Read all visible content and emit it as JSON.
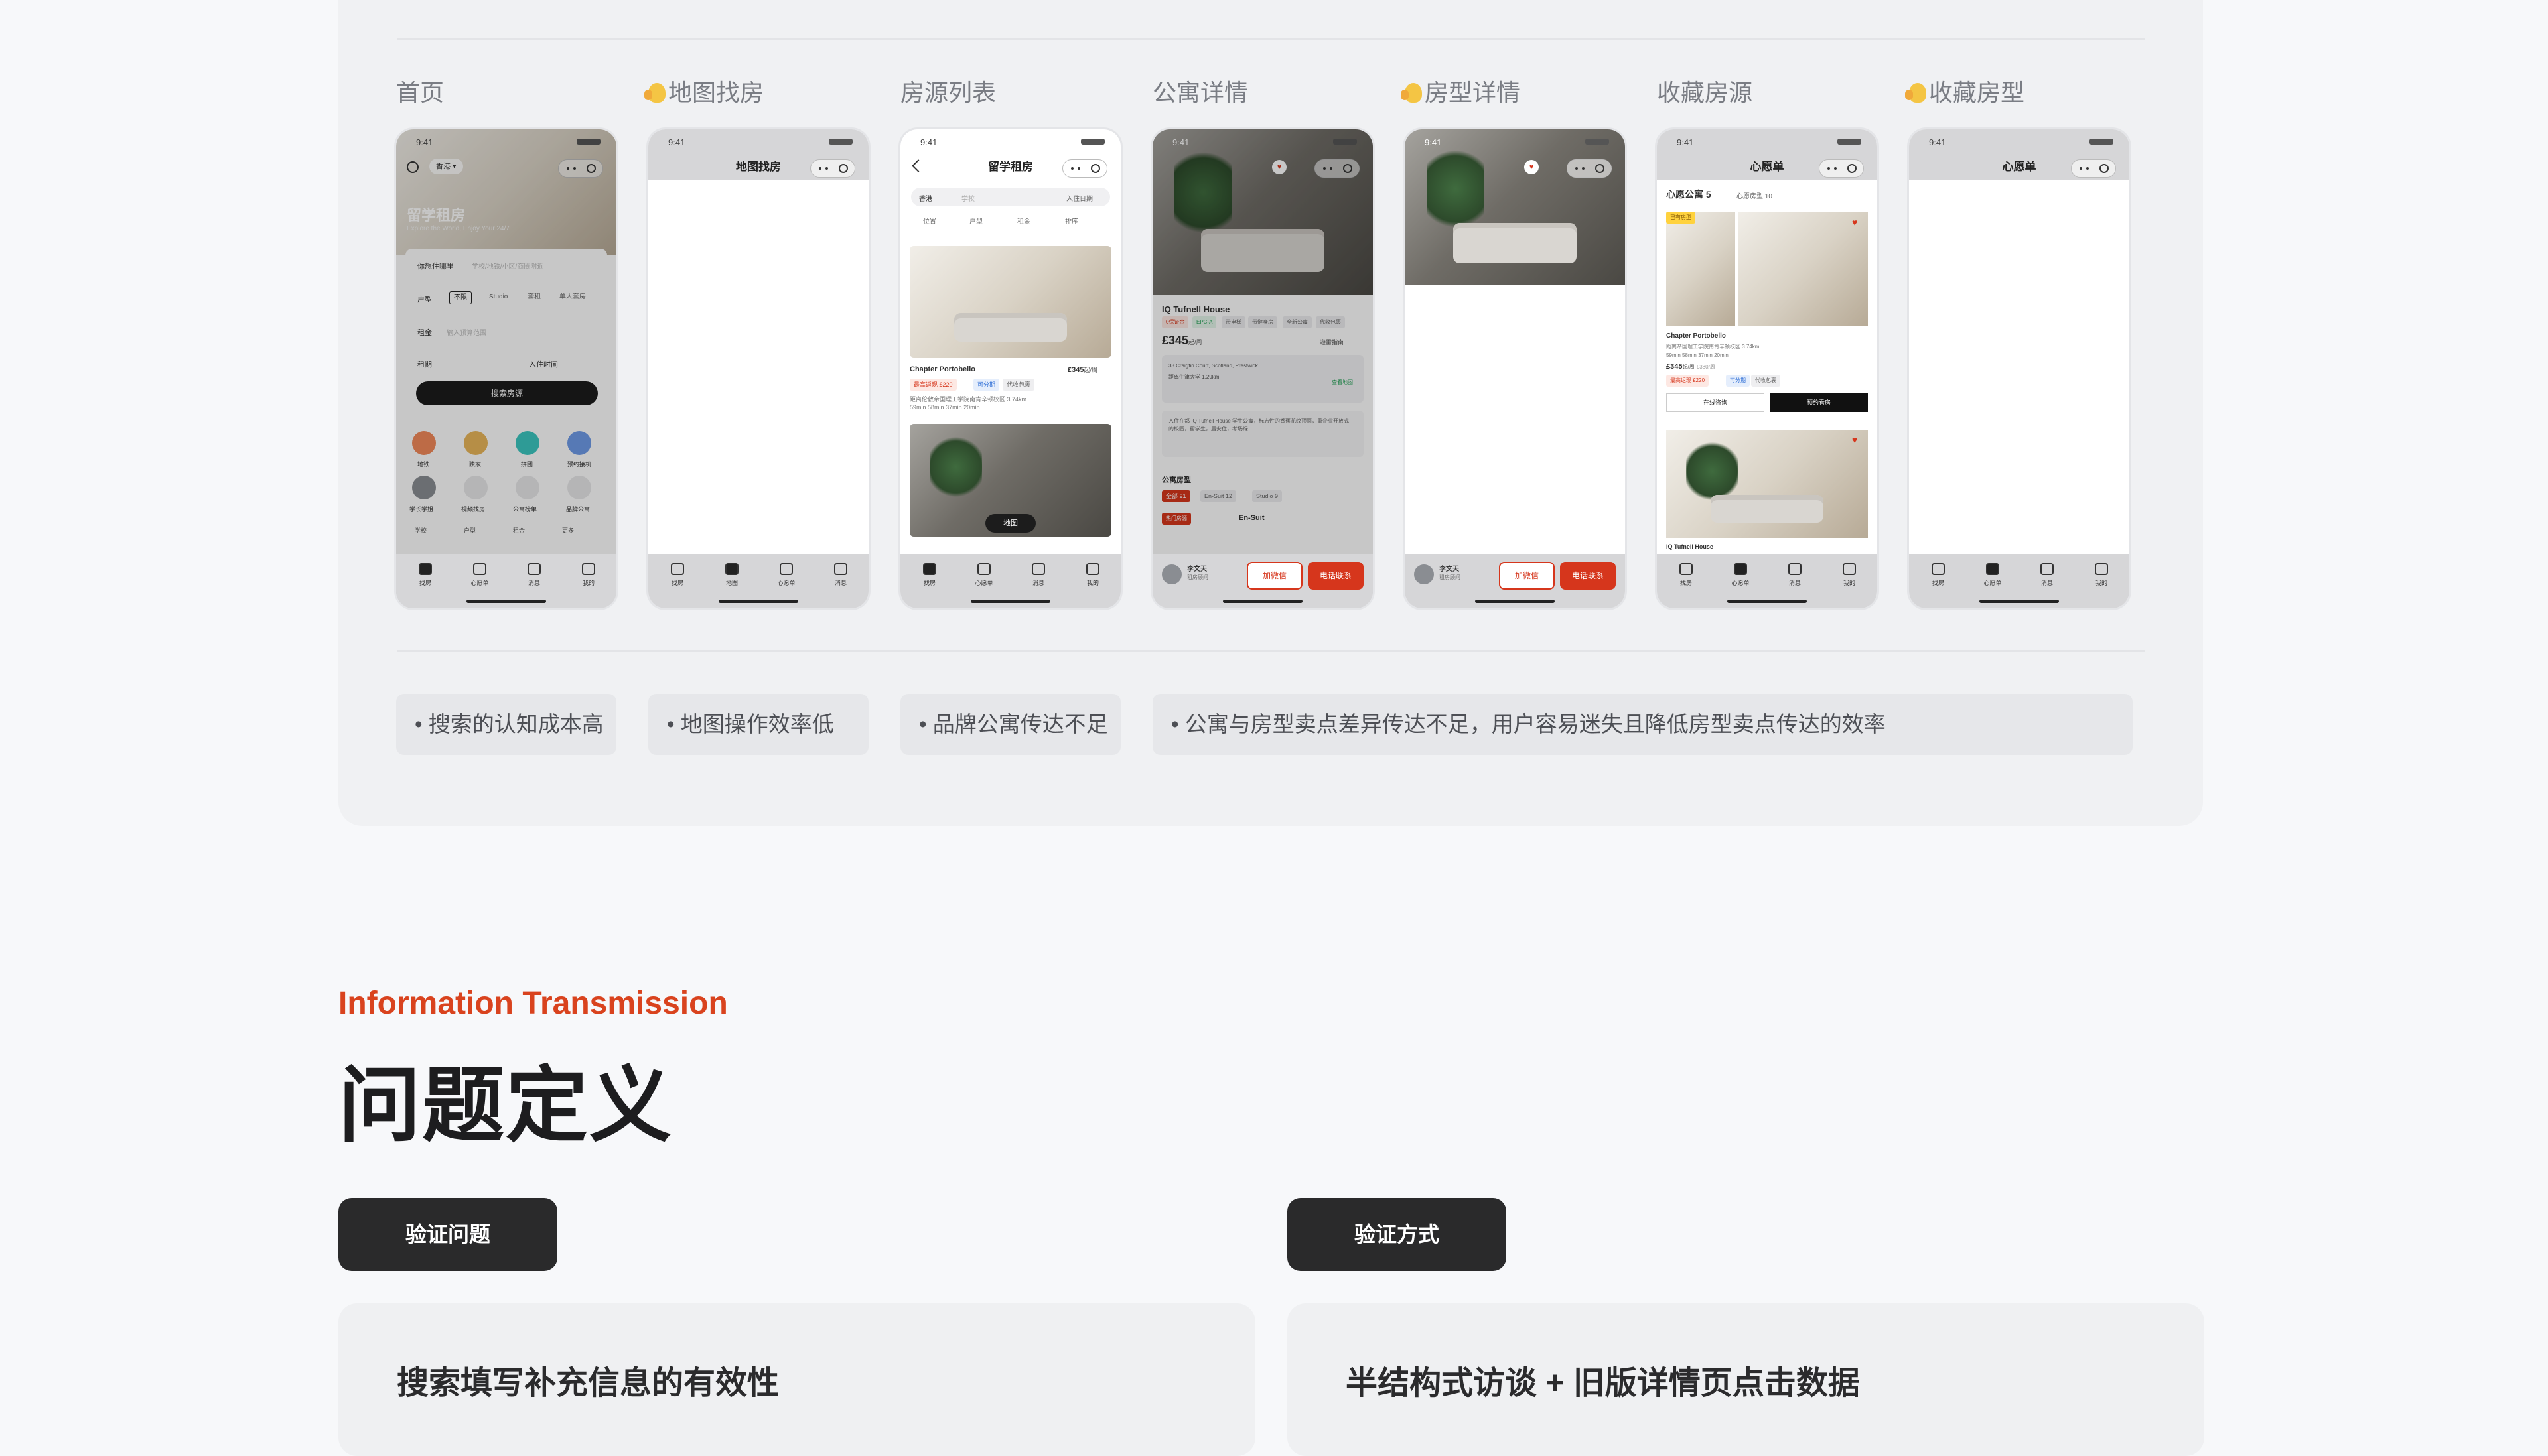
{
  "screens": [
    {
      "label": "首页",
      "emoji": false
    },
    {
      "label": "地图找房",
      "emoji": true
    },
    {
      "label": "房源列表",
      "emoji": false
    },
    {
      "label": "公寓详情",
      "emoji": false
    },
    {
      "label": "房型详情",
      "emoji": true
    },
    {
      "label": "收藏房源",
      "emoji": false
    },
    {
      "label": "收藏房型",
      "emoji": true
    }
  ],
  "phones": {
    "time": "9:41",
    "home": {
      "city": "香港",
      "hero_title": "留学租房",
      "hero_sub": "Explore the World, Enjoy Your 24/7",
      "field_school": "你想住哪里",
      "field_school_ph": "学校/地铁/小区/商圈附近",
      "field_type": "户型",
      "type_options": [
        "不限",
        "Studio",
        "套租",
        "单人套房"
      ],
      "field_rent": "租金",
      "field_rent_ph": "输入预算范围",
      "field_term": "租期",
      "field_checkin": "入住时间",
      "search_btn": "搜索房源",
      "cats": [
        "地铁",
        "独家",
        "拼团",
        "预约接机",
        "学长学姐",
        "视频找房",
        "公寓榜单",
        "品牌公寓"
      ],
      "filters": [
        "学校",
        "户型",
        "租金",
        "更多"
      ]
    },
    "map": {
      "nav_title": "地图找房"
    },
    "list": {
      "nav_title": "留学租房",
      "city": "香港",
      "search_ph": "学校",
      "checkin": "入住日期",
      "filters": [
        "位置",
        "户型",
        "租金",
        "排序"
      ],
      "item1_name": "Chapter Portobello",
      "item1_price": "£345",
      "item1_unit": "起/周",
      "item1_tag1": "最高返现 £220",
      "item1_tag2": "可分期",
      "item1_tag3": "代收包裹",
      "item1_addr": "距离伦敦帝国理工学院南肯辛顿校区 3.74km",
      "item1_times": [
        "59min",
        "58min",
        "37min",
        "20min"
      ],
      "map_btn": "地图"
    },
    "apt": {
      "name": "IQ Tufnell House",
      "tags": [
        "0保证金",
        "EPC-A",
        "带电梯",
        "带健身房",
        "全新公寓",
        "代收包裹"
      ],
      "price": "£345",
      "unit": "起/周",
      "guarantee": "避雷指南",
      "addr": "33 Craigfin Court, Scotland, Prestwick",
      "near": "距离牛津大学 1.29km",
      "map_tag": "查看地图",
      "desc": "入住在都 IQ Tufnell House 学生公寓，标志性的香蕉花纹顶面，重企业开放式的校园，留学生，居安住，考场绿",
      "types_title": "公寓房型",
      "type_tabs": [
        "全部 21",
        "En-Suit 12",
        "Studio 9"
      ],
      "hot": "热门房源",
      "en_suit": "En-Suit",
      "agent_name": "李文天",
      "agent_role": "租房顾问",
      "wechat_btn": "加微信",
      "call_btn": "电话联系"
    },
    "room": {
      "agent_name": "李文天",
      "agent_role": "租房顾问",
      "wechat_btn": "加微信",
      "call_btn": "电话联系"
    },
    "fav": {
      "nav_title": "心愿单",
      "tab_apt": "心愿公寓 5",
      "tab_type": "心愿房型 10",
      "badge": "已有房型",
      "name": "Chapter Portobello",
      "addr": "距离帝国理工学院南肯辛顿校区 3.74km",
      "times": [
        "59min",
        "58min",
        "37min",
        "20min"
      ],
      "price": "£345",
      "unit": "起/周",
      "old_price": "£380/周",
      "tag1": "最高返现 £220",
      "tag2": "可分期",
      "tag3": "代收包裹",
      "btn_online": "在线咨询",
      "btn_book": "预约看房",
      "next": "IQ Tufnell House"
    },
    "fav_type": {
      "nav_title": "心愿单"
    },
    "tabs": [
      "找房",
      "心愿单",
      "消息",
      "我的"
    ],
    "tabs_map": [
      "找房",
      "地图",
      "心愿单",
      "消息"
    ]
  },
  "pain_points": [
    "搜索的认知成本高",
    "地图操作效率低",
    "品牌公寓传达不足",
    "公寓与房型卖点差异传达不足，用户容易迷失且降低房型卖点传达的效率"
  ],
  "section": {
    "subtitle": "Information Transmission",
    "title": "问题定义",
    "pill_left": "验证问题",
    "pill_right": "验证方式",
    "card_left": "搜索填写补充信息的有效性",
    "card_right": "半结构式访谈 + 旧版详情页点击数据"
  },
  "colors": {
    "accent": "#d9431e",
    "dark": "#2a2a2b",
    "panel": "#f0f1f3"
  }
}
